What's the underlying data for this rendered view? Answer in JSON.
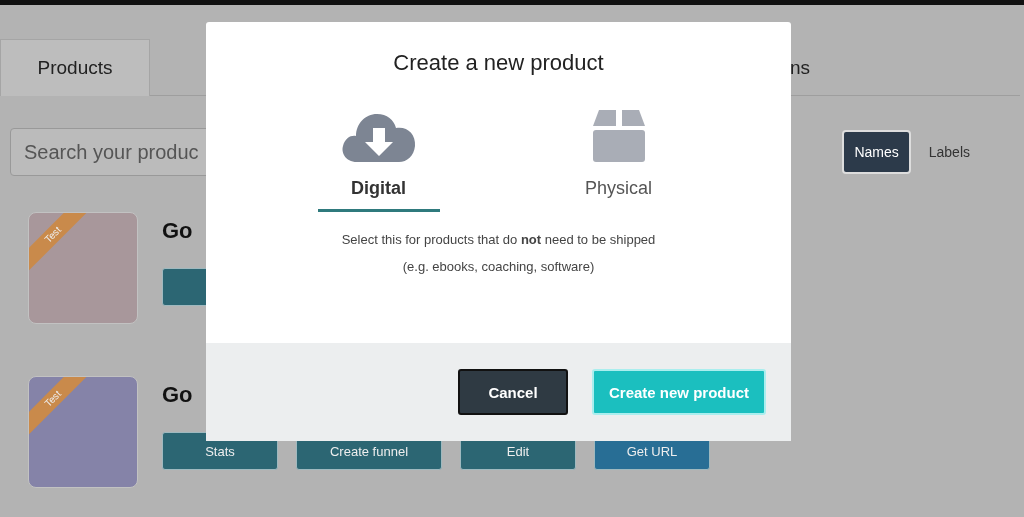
{
  "tabs": [
    {
      "label": "Products",
      "selected": true
    },
    {
      "label": "ns",
      "selected": false
    }
  ],
  "search": {
    "placeholder": "Search your produc"
  },
  "view_toggle": [
    {
      "label": "Names",
      "selected": true
    },
    {
      "label": "Labels",
      "selected": false
    }
  ],
  "products": [
    {
      "title": "Go",
      "color": "#a8979b",
      "ribbon": "Test",
      "buttons": [
        {
          "kind": "action"
        }
      ]
    },
    {
      "title": "Go",
      "color": "#8583a8",
      "ribbon": "Test",
      "buttons": [
        {
          "label": "Stats",
          "kind": "action"
        },
        {
          "label": "Create funnel",
          "kind": "action"
        },
        {
          "label": "Edit",
          "kind": "action"
        },
        {
          "label": "Get URL",
          "kind": "url"
        }
      ]
    }
  ],
  "modal": {
    "title": "Create a new product",
    "options": [
      {
        "label": "Digital",
        "kind": "digital",
        "selected": true
      },
      {
        "label": "Physical",
        "kind": "physical",
        "selected": false
      }
    ],
    "description": [
      "Select this for products that do **not** need to be shipped",
      "(e.g. ebooks, coaching, software)"
    ],
    "buttons": [
      {
        "label": "Cancel",
        "kind": "cancel"
      },
      {
        "label": "Create new product",
        "kind": "primary"
      }
    ]
  }
}
